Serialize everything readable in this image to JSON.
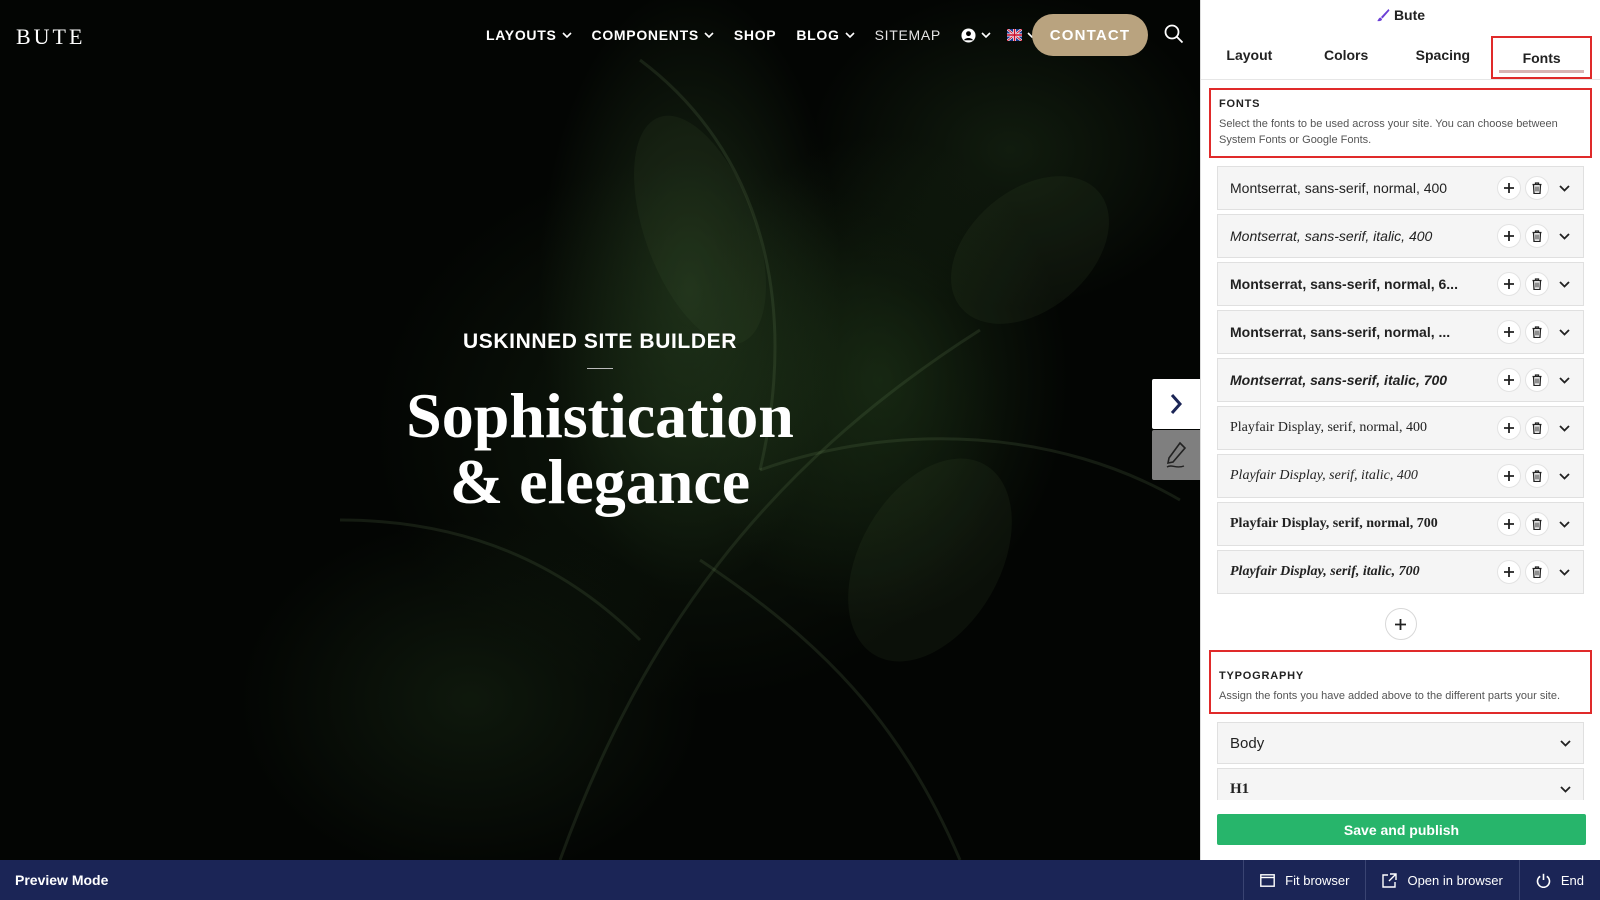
{
  "site": {
    "logo": "BUTE",
    "nav": [
      {
        "label": "LAYOUTS",
        "dropdown": true
      },
      {
        "label": "COMPONENTS",
        "dropdown": true
      },
      {
        "label": "SHOP",
        "dropdown": false
      },
      {
        "label": "BLOG",
        "dropdown": true
      },
      {
        "label": "SITEMAP",
        "dropdown": false
      }
    ],
    "contact_label": "CONTACT",
    "hero": {
      "kicker": "USKINNED SITE BUILDER",
      "title_line1": "Sophistication",
      "title_line2": "& elegance"
    }
  },
  "panel": {
    "title": "Bute",
    "tabs": [
      "Layout",
      "Colors",
      "Spacing",
      "Fonts"
    ],
    "active_tab": "Fonts",
    "fonts_section": {
      "title": "FONTS",
      "description": "Select the fonts to be used across your site. You can choose between System Fonts or Google Fonts."
    },
    "fonts": [
      "Montserrat, sans-serif, normal, 400",
      "Montserrat, sans-serif, italic, 400",
      "Montserrat, sans-serif, normal, 6...",
      "Montserrat, sans-serif, normal, ...",
      "Montserrat, sans-serif, italic, 700",
      "Playfair Display, serif, normal, 400",
      "Playfair Display, serif, italic, 400",
      "Playfair Display, serif, normal, 700",
      "Playfair Display, serif, italic, 700"
    ],
    "typography_section": {
      "title": "TYPOGRAPHY",
      "description": "Assign the fonts you have added above to the different parts your site."
    },
    "typography_items": [
      "Body",
      "H1"
    ],
    "save_label": "Save and publish"
  },
  "footer": {
    "mode": "Preview Mode",
    "fit_browser": "Fit browser",
    "open_in_browser": "Open in browser",
    "end": "End"
  },
  "colors": {
    "contact_button": "#b9a37f",
    "save_button": "#27b56b",
    "footer_bg": "#1b2556",
    "highlight": "#e02a2a"
  }
}
